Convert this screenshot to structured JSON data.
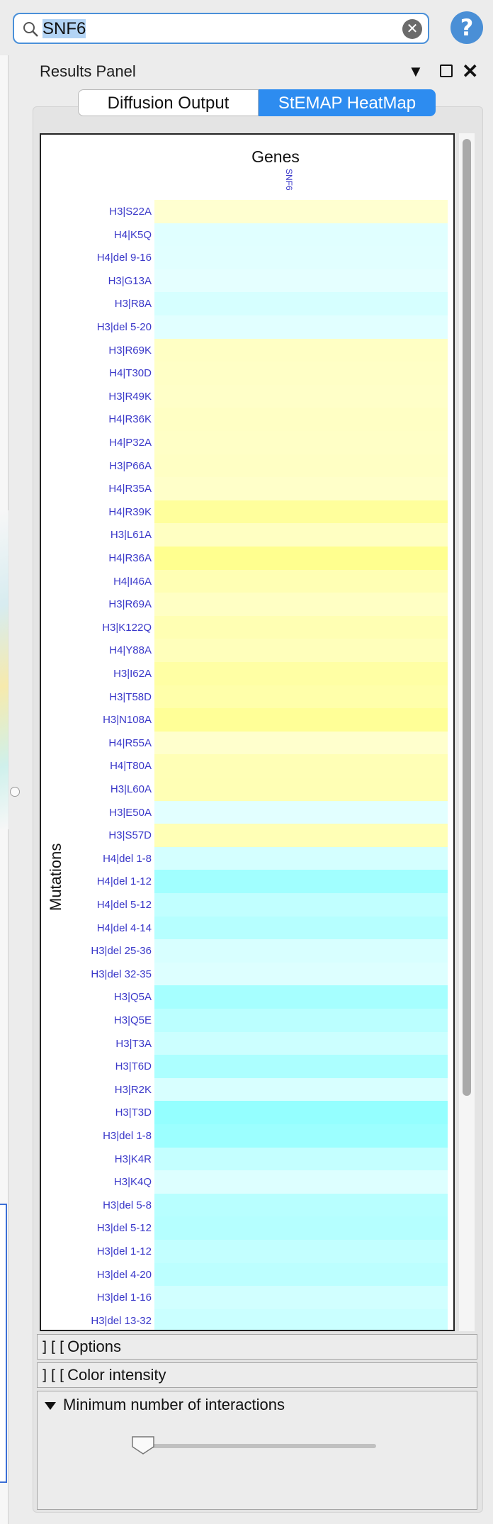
{
  "search": {
    "value_prefix": "",
    "value_selected": "SNF6",
    "clear_label": "✕",
    "help_label": "?"
  },
  "panel": {
    "title": "Results Panel",
    "dropdown_glyph": "▼",
    "close_glyph": "✕"
  },
  "tabs": [
    {
      "label": "Diffusion Output",
      "active": false
    },
    {
      "label": "StEMAP HeatMap",
      "active": true
    }
  ],
  "heatmap": {
    "genes_title": "Genes",
    "mutations_title": "Mutations",
    "gene": "SNF6",
    "rows": [
      {
        "label": "H3|S22A",
        "color": "#ffffd0"
      },
      {
        "label": "H4|K5Q",
        "color": "#e0ffff"
      },
      {
        "label": "H4|del 9-16",
        "color": "#e1ffff"
      },
      {
        "label": "H3|G13A",
        "color": "#e5ffff"
      },
      {
        "label": "H3|R8A",
        "color": "#d6ffff"
      },
      {
        "label": "H3|del 5-20",
        "color": "#e1ffff"
      },
      {
        "label": "H3|R69K",
        "color": "#ffffc4"
      },
      {
        "label": "H4|T30D",
        "color": "#ffffc6"
      },
      {
        "label": "H3|R49K",
        "color": "#ffffc8"
      },
      {
        "label": "H4|R36K",
        "color": "#ffffc4"
      },
      {
        "label": "H4|P32A",
        "color": "#ffffc6"
      },
      {
        "label": "H3|P66A",
        "color": "#ffffc4"
      },
      {
        "label": "H4|R35A",
        "color": "#ffffc9"
      },
      {
        "label": "H4|R39K",
        "color": "#ffff9c"
      },
      {
        "label": "H3|L61A",
        "color": "#ffffc2"
      },
      {
        "label": "H4|R36A",
        "color": "#ffff8f"
      },
      {
        "label": "H4|I46A",
        "color": "#ffffb4"
      },
      {
        "label": "H3|R69A",
        "color": "#ffffc4"
      },
      {
        "label": "H3|K122Q",
        "color": "#ffffb3"
      },
      {
        "label": "H4|Y88A",
        "color": "#ffffbb"
      },
      {
        "label": "H3|I62A",
        "color": "#ffffa4"
      },
      {
        "label": "H3|T58D",
        "color": "#ffffaa"
      },
      {
        "label": "H3|N108A",
        "color": "#ffff97"
      },
      {
        "label": "H4|R55A",
        "color": "#ffffcd"
      },
      {
        "label": "H4|T80A",
        "color": "#ffffb6"
      },
      {
        "label": "H3|L60A",
        "color": "#ffffb5"
      },
      {
        "label": "H3|E50A",
        "color": "#e2ffff"
      },
      {
        "label": "H3|S57D",
        "color": "#ffffb6"
      },
      {
        "label": "H4|del 1-8",
        "color": "#d4ffff"
      },
      {
        "label": "H4|del 1-12",
        "color": "#a1ffff"
      },
      {
        "label": "H4|del 5-12",
        "color": "#c1ffff"
      },
      {
        "label": "H4|del 4-14",
        "color": "#b6ffff"
      },
      {
        "label": "H3|del 25-36",
        "color": "#d8ffff"
      },
      {
        "label": "H3|del 32-35",
        "color": "#ddffff"
      },
      {
        "label": "H3|Q5A",
        "color": "#a6ffff"
      },
      {
        "label": "H3|Q5E",
        "color": "#bbffff"
      },
      {
        "label": "H3|T3A",
        "color": "#ccffff"
      },
      {
        "label": "H3|T6D",
        "color": "#acffff"
      },
      {
        "label": "H3|R2K",
        "color": "#d8ffff"
      },
      {
        "label": "H3|T3D",
        "color": "#94ffff"
      },
      {
        "label": "H3|del 1-8",
        "color": "#9cffff"
      },
      {
        "label": "H3|K4R",
        "color": "#c4ffff"
      },
      {
        "label": "H3|K4Q",
        "color": "#ddffff"
      },
      {
        "label": "H3|del 5-8",
        "color": "#b8ffff"
      },
      {
        "label": "H3|del 5-12",
        "color": "#b5ffff"
      },
      {
        "label": "H3|del 1-12",
        "color": "#c3ffff"
      },
      {
        "label": "H3|del 4-20",
        "color": "#bcffff"
      },
      {
        "label": "H3|del 1-16",
        "color": "#d1ffff"
      },
      {
        "label": "H3|del 13-32",
        "color": "#caffff"
      }
    ]
  },
  "sections": {
    "options": "Options",
    "color_intensity": "Color intensity",
    "min_interactions": "Minimum number of interactions",
    "bracket_glyph": "][[",
    "slider_value_fraction": 0.0
  }
}
